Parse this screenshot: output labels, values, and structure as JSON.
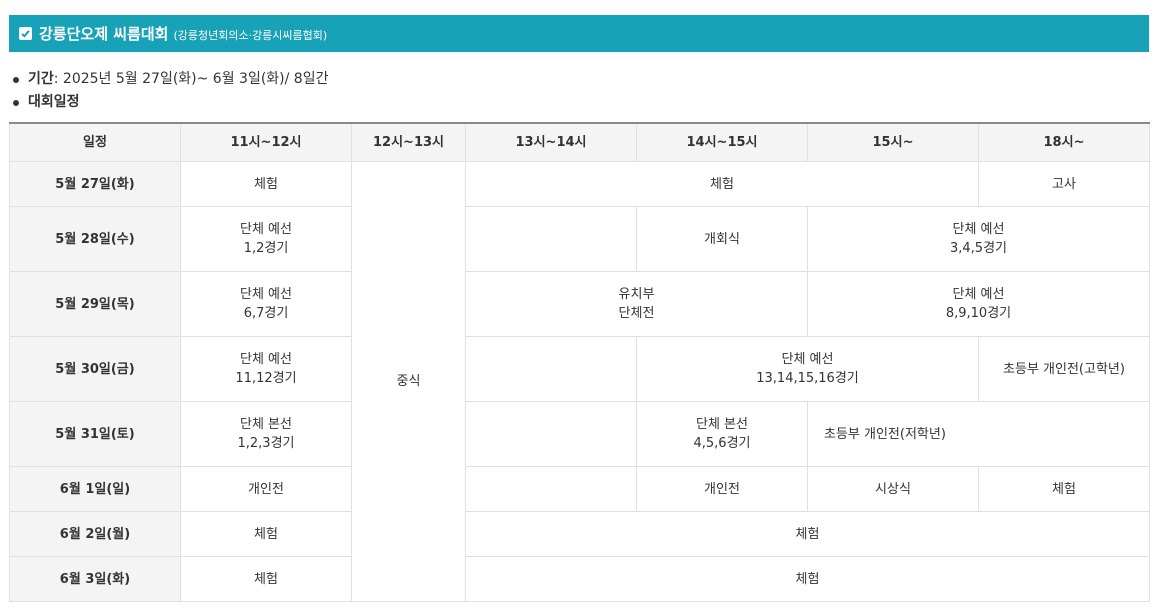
{
  "banner": {
    "title": "강릉단오제 씨름대회",
    "subtitle": "(강릉청년회의소·강릉시씨름협회)",
    "icon": "checkbox-checked-icon",
    "color": "#17a2b8"
  },
  "info": {
    "period_label": "기간",
    "period_value": " : 2025년 5월 27일(화)~ 6월 3일(화)/ 8일간",
    "schedule_label": "대회일정"
  },
  "table": {
    "headers": [
      "일정",
      "11시~12시",
      "12시~13시",
      "13시~14시",
      "14시~15시",
      "15시~",
      "18시~"
    ],
    "lunch": "중식",
    "rows": [
      {
        "date": "5월 27일(화)",
        "c11": "체험",
        "c13_15": "체험",
        "c18": "고사"
      },
      {
        "date": "5월 28일(수)",
        "c11a": "단체 예선",
        "c11b": "1,2경기",
        "c13": "",
        "c14": "개회식",
        "c15a": "단체 예선",
        "c15b": "3,4,5경기"
      },
      {
        "date": "5월 29일(목)",
        "c11a": "단체 예선",
        "c11b": "6,7경기",
        "c13a": "유치부",
        "c13b": "단체전",
        "c15a": "단체 예선",
        "c15b": "8,9,10경기"
      },
      {
        "date": "5월 30일(금)",
        "c11a": "단체 예선",
        "c11b": "11,12경기",
        "c13": "",
        "c14a": "단체 예선",
        "c14b": "13,14,15,16경기",
        "c18": "초등부 개인전(고학년)"
      },
      {
        "date": "5월 31일(토)",
        "c11a": "단체 본선",
        "c11b": "1,2,3경기",
        "c13": "",
        "c14a": "단체 본선",
        "c14b": "4,5,6경기",
        "c15": "초등부 개인전(저학년)"
      },
      {
        "date": "6월 1일(일)",
        "c11": "개인전",
        "c13": "",
        "c14": "개인전",
        "c15": "시상식",
        "c18": "체험"
      },
      {
        "date": "6월 2일(월)",
        "c11": "체험",
        "c13_18": "체험"
      },
      {
        "date": "6월 3일(화)",
        "c11": "체험",
        "c13_18": "체험"
      }
    ]
  }
}
